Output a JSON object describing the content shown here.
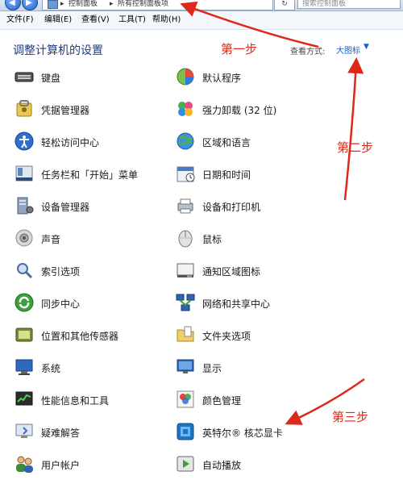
{
  "address_bar": {
    "crumbs": [
      "控制面板",
      "所有控制面板项"
    ],
    "refresh_glyph": "↻",
    "search_placeholder": "搜索控制面板"
  },
  "menu": [
    {
      "label": "文件(F)"
    },
    {
      "label": "编辑(E)"
    },
    {
      "label": "查看(V)"
    },
    {
      "label": "工具(T)"
    },
    {
      "label": "帮助(H)"
    }
  ],
  "header": {
    "title": "调整计算机的设置",
    "view_label": "查看方式:",
    "view_value": "大图标"
  },
  "items_left": [
    {
      "label": "键盘",
      "icon": "keyboard-icon"
    },
    {
      "label": "凭据管理器",
      "icon": "credential-manager-icon"
    },
    {
      "label": "轻松访问中心",
      "icon": "ease-of-access-icon"
    },
    {
      "label": "任务栏和「开始」菜单",
      "icon": "taskbar-icon"
    },
    {
      "label": "设备管理器",
      "icon": "device-manager-icon"
    },
    {
      "label": "声音",
      "icon": "sound-icon"
    },
    {
      "label": "索引选项",
      "icon": "indexing-icon"
    },
    {
      "label": "同步中心",
      "icon": "sync-center-icon"
    },
    {
      "label": "位置和其他传感器",
      "icon": "location-sensor-icon"
    },
    {
      "label": "系统",
      "icon": "system-icon"
    },
    {
      "label": "性能信息和工具",
      "icon": "performance-icon"
    },
    {
      "label": "疑难解答",
      "icon": "troubleshooting-icon"
    },
    {
      "label": "用户帐户",
      "icon": "user-accounts-icon"
    }
  ],
  "items_right": [
    {
      "label": "默认程序",
      "icon": "default-programs-icon"
    },
    {
      "label": "强力卸载 (32 位)",
      "icon": "uninstaller-icon"
    },
    {
      "label": "区域和语言",
      "icon": "region-language-icon"
    },
    {
      "label": "日期和时间",
      "icon": "date-time-icon"
    },
    {
      "label": "设备和打印机",
      "icon": "devices-printers-icon"
    },
    {
      "label": "鼠标",
      "icon": "mouse-icon"
    },
    {
      "label": "通知区域图标",
      "icon": "notification-area-icon"
    },
    {
      "label": "网络和共享中心",
      "icon": "network-sharing-icon"
    },
    {
      "label": "文件夹选项",
      "icon": "folder-options-icon"
    },
    {
      "label": "显示",
      "icon": "display-icon"
    },
    {
      "label": "颜色管理",
      "icon": "color-management-icon"
    },
    {
      "label": "英特尔® 核芯显卡",
      "icon": "intel-graphics-icon"
    },
    {
      "label": "自动播放",
      "icon": "autoplay-icon"
    }
  ],
  "annotations": {
    "step1": "第一步",
    "step2": "第二步",
    "step3": "第三步",
    "color": "#e0281a"
  }
}
